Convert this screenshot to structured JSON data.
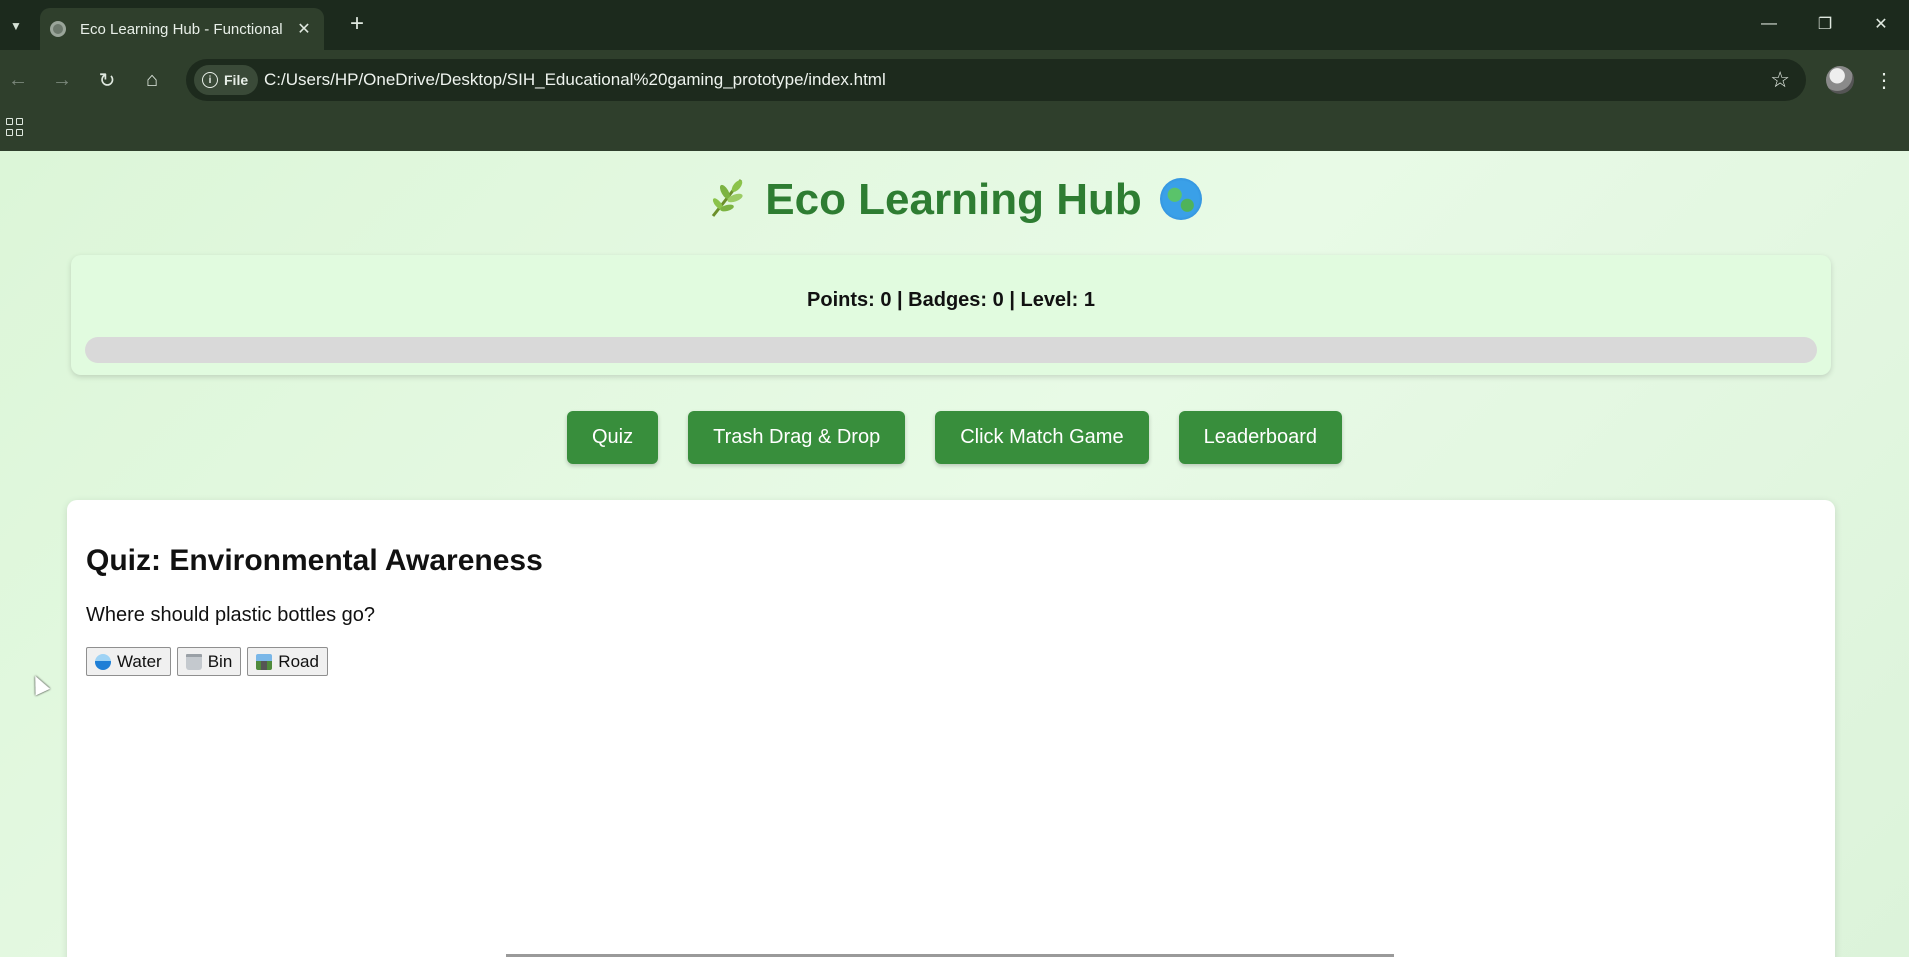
{
  "browser": {
    "tab_title": "Eco Learning Hub - Functional",
    "omnibox": {
      "site_chip_label": "File",
      "url": "C:/Users/HP/OneDrive/Desktop/SIH_Educational%20gaming_prototype/index.html"
    },
    "icons": {
      "tab_list": "chevron-down-icon",
      "favicon": "globe-icon",
      "close_tab": "close-icon",
      "new_tab": "plus-icon",
      "back": "back-arrow-icon",
      "forward": "forward-arrow-icon",
      "reload": "reload-icon",
      "home": "home-icon",
      "site_info": "info-icon",
      "bookmark": "star-icon",
      "profile": "avatar-icon",
      "menu": "kebab-menu-icon",
      "apps": "apps-grid-icon",
      "minimize": "minimize-icon",
      "restore": "restore-icon",
      "close_window": "close-icon"
    }
  },
  "page": {
    "title": "Eco Learning Hub",
    "title_icons": [
      "leaf-icon",
      "globe-icon"
    ],
    "stats_text": "Points: 0 | Badges: 0 | Level: 1",
    "progress_fraction": 0,
    "nav_buttons": [
      "Quiz",
      "Trash Drag & Drop",
      "Click Match Game",
      "Leaderboard"
    ],
    "quiz": {
      "title": "Quiz: Environmental Awareness",
      "question": "Where should plastic bottles go?",
      "answers": [
        {
          "label": "Water",
          "icon": "water-wave-icon"
        },
        {
          "label": "Bin",
          "icon": "trash-bin-icon"
        },
        {
          "label": "Road",
          "icon": "road-icon"
        }
      ]
    },
    "colors": {
      "accent_green": "#388e3c",
      "title_green": "#2e7d32",
      "stats_card_bg": "#e1fbdf",
      "progress_track": "#d9d9d9"
    }
  }
}
